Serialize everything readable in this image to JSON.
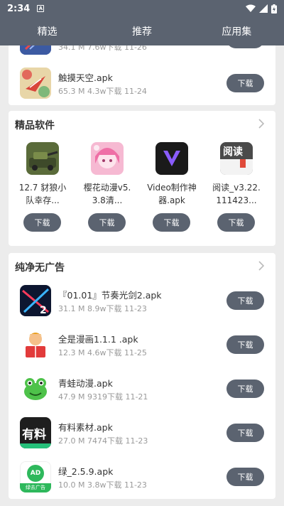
{
  "status_bar": {
    "time": "2:34",
    "notif_letter": "A"
  },
  "tabs": [
    {
      "label": "精选"
    },
    {
      "label": "推荐"
    },
    {
      "label": "应用集"
    }
  ],
  "top_list": [
    {
      "name": "",
      "meta": "34.1 M  7.6w下载  11-26",
      "button": "下载"
    },
    {
      "name": "触摸天空.apk",
      "meta": "65.3 M  4.3w下载  11-24",
      "button": "下载"
    }
  ],
  "featured": {
    "title": "精品软件",
    "items": [
      {
        "name": "12.7 豺狼小队幸存...",
        "button": "下载"
      },
      {
        "name": "樱花动漫v5.3.8清...",
        "button": "下载"
      },
      {
        "name": "Video制作神器.apk",
        "button": "下载"
      },
      {
        "name": "阅读_v3.22.111423...",
        "button": "下载"
      }
    ]
  },
  "adfree": {
    "title": "纯净无广告",
    "items": [
      {
        "name": "『01.01』节奏光剑2.apk",
        "meta": "31.1 M  8.9w下载  11-23",
        "button": "下载"
      },
      {
        "name": "全是漫画1.1.1 .apk",
        "meta": "12.3 M  4.6w下载  11-25",
        "button": "下载"
      },
      {
        "name": "青蛙动漫.apk",
        "meta": "47.9 M  9319下载  11-21",
        "button": "下载"
      },
      {
        "name": "有料素材.apk",
        "meta": "27.0 M  7474下载  11-23",
        "button": "下载"
      },
      {
        "name": "绿_2.5.9.apk",
        "meta": "10.0 M  3.8w下载  11-23",
        "button": "下载"
      }
    ]
  },
  "icon_text": {
    "youliao": "有料",
    "read": "阅读",
    "green_ad": "AD",
    "green_caption": "绿去广告"
  }
}
